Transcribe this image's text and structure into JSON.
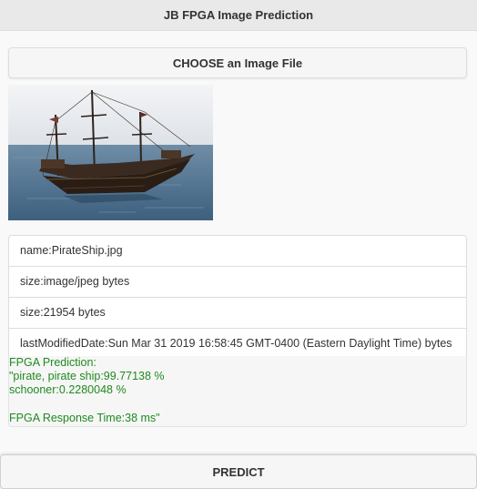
{
  "header": {
    "title": "JB FPGA Image Prediction"
  },
  "choose_button": {
    "label": "CHOOSE an Image File"
  },
  "file_info": [
    {
      "text": "name:PirateShip.jpg"
    },
    {
      "text": "size:image/jpeg bytes"
    },
    {
      "text": "size:21954 bytes"
    },
    {
      "text": "lastModifiedDate:Sun Mar 31 2019 16:58:45 GMT-0400 (Eastern Daylight Time) bytes"
    }
  ],
  "prediction": {
    "text": "FPGA Prediction:\n\"pirate, pirate ship:99.77138 %\nschooner:0.2280048 %\n\nFPGA Response Time:38 ms\"",
    "color": "#1f8a1f"
  },
  "predict_button": {
    "label": "PREDICT"
  }
}
